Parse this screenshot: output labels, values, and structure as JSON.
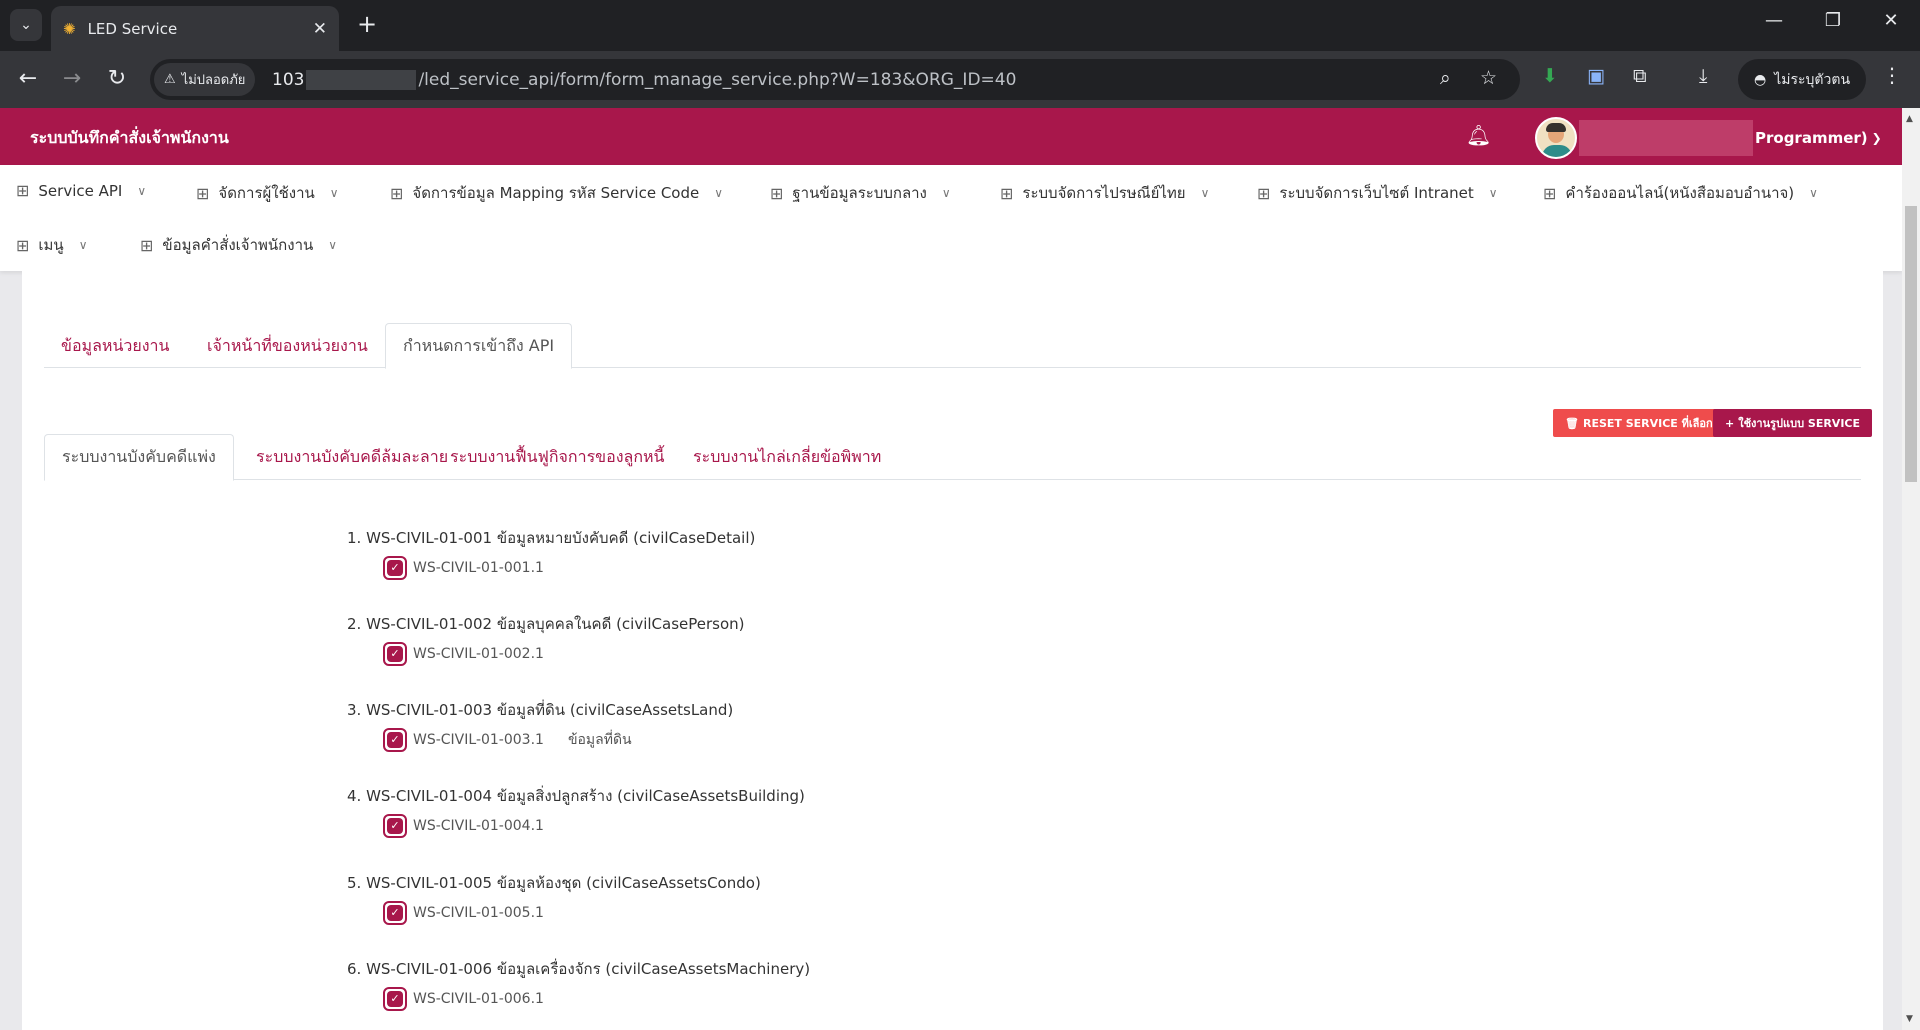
{
  "browser": {
    "tab_title": "LED Service",
    "security_label": "ไม่ปลอดภัย",
    "url_host": "103",
    "url_path": "/led_service_api/form/form_manage_service.php?W=183&ORG_ID=40",
    "profile_label": "ไม่ระบุตัวตน"
  },
  "app": {
    "title": "ระบบบันทึกคำสั่งเจ้าพนักงาน",
    "user_role": "Programmer)"
  },
  "menu": [
    {
      "label": "Service API"
    },
    {
      "label": "จัดการผู้ใช้งาน"
    },
    {
      "label": "จัดการข้อมูล Mapping รหัส Service Code"
    },
    {
      "label": "ฐานข้อมูลระบบกลาง"
    },
    {
      "label": "ระบบจัดการไปรษณีย์ไทย"
    },
    {
      "label": "ระบบจัดการเว็บไซต์ Intranet"
    },
    {
      "label": "คำร้องออนไลน์(หนังสือมอบอำนาจ)"
    },
    {
      "label": "เมนู"
    },
    {
      "label": "ข้อมูลคำสั่งเจ้าพนักงาน"
    }
  ],
  "page_tabs": [
    {
      "label": "ข้อมูลหน่วยงาน"
    },
    {
      "label": "เจ้าหน้าที่ของหน่วยงาน"
    },
    {
      "label": "กำหนดการเข้าถึง API"
    }
  ],
  "buttons": {
    "reset": "RESET SERVICE ที่เลือก",
    "template": "ใช้งานรูปแบบ SERVICE"
  },
  "system_tabs": [
    {
      "label": "ระบบงานบังคับคดีแพ่ง"
    },
    {
      "label": "ระบบงานบังคับคดีล้มละลาย"
    },
    {
      "label": "ระบบงานฟื้นฟูกิจการของลูกหนี้"
    },
    {
      "label": "ระบบงานไกล่เกลี่ยข้อพิพาท"
    }
  ],
  "services": [
    {
      "title": "1. WS-CIVIL-01-001 ข้อมูลหมายบังคับคดี (civilCaseDetail)",
      "code": "WS-CIVIL-01-001.1",
      "desc": "",
      "checked": true
    },
    {
      "title": "2. WS-CIVIL-01-002 ข้อมูลบุคคลในคดี (civilCasePerson)",
      "code": "WS-CIVIL-01-002.1",
      "desc": "",
      "checked": true
    },
    {
      "title": "3. WS-CIVIL-01-003 ข้อมูลที่ดิน (civilCaseAssetsLand)",
      "code": "WS-CIVIL-01-003.1",
      "desc": "ข้อมูลที่ดิน",
      "checked": true
    },
    {
      "title": "4. WS-CIVIL-01-004 ข้อมูลสิ่งปลูกสร้าง (civilCaseAssetsBuilding)",
      "code": "WS-CIVIL-01-004.1",
      "desc": "",
      "checked": true
    },
    {
      "title": "5. WS-CIVIL-01-005 ข้อมูลห้องชุด (civilCaseAssetsCondo)",
      "code": "WS-CIVIL-01-005.1",
      "desc": "",
      "checked": true
    },
    {
      "title": "6. WS-CIVIL-01-006 ข้อมูลเครื่องจักร (civilCaseAssetsMachinery)",
      "code": "WS-CIVIL-01-006.1",
      "desc": "",
      "checked": true
    }
  ],
  "colors": {
    "brand": "#a8174b",
    "reset_button": "#ef4c4c"
  }
}
